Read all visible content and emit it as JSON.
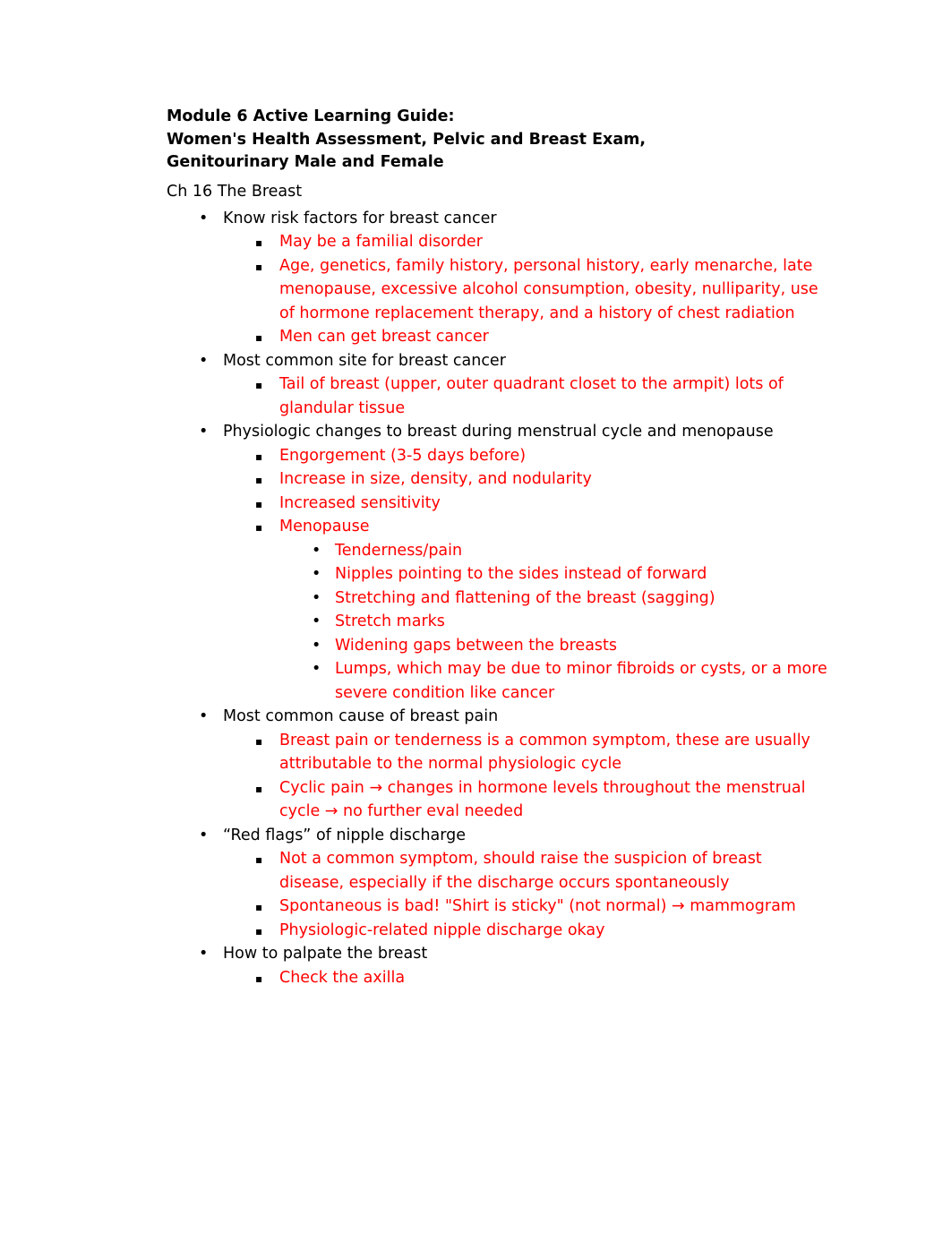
{
  "document": {
    "title_lines": [
      "Module 6 Active Learning Guide:",
      "Women's Health Assessment, Pelvic and Breast Exam,",
      "Genitourinary Male and Female"
    ],
    "chapter_heading": "Ch 16 The Breast",
    "colors": {
      "body_text": "#000000",
      "answer_text": "#ff0000",
      "page_background": "#ffffff"
    },
    "bullet_glyphs": {
      "level1": "•",
      "level2": "▪",
      "level3": "•"
    }
  },
  "outline": [
    {
      "id": "risk-factors",
      "text": "Know risk factors for breast cancer",
      "children": [
        {
          "id": "familial",
          "text": "May be a familial disorder"
        },
        {
          "id": "risk-list",
          "text": "Age, genetics, family history, personal history, early menarche, late menopause, excessive alcohol consumption, obesity, nulliparity, use of hormone replacement therapy, and a history of chest radiation"
        },
        {
          "id": "men-breast-cancer",
          "text": "Men can get breast cancer"
        }
      ]
    },
    {
      "id": "common-site",
      "text": "Most common site for breast cancer",
      "children": [
        {
          "id": "tail-of-breast",
          "text": "Tail of breast (upper, outer quadrant closet to the armpit) lots of glandular tissue"
        }
      ]
    },
    {
      "id": "physiologic-changes",
      "text": "Physiologic changes to breast during menstrual cycle and menopause",
      "children": [
        {
          "id": "engorgement",
          "text": "Engorgement (3-5 days before)"
        },
        {
          "id": "increase-size",
          "text": "Increase in size, density, and nodularity"
        },
        {
          "id": "increased-sensitivity",
          "text": "Increased sensitivity"
        },
        {
          "id": "menopause",
          "text": "Menopause",
          "children": [
            {
              "id": "tenderness-pain",
              "text": "Tenderness/pain"
            },
            {
              "id": "nipples-sides",
              "text": "Nipples pointing to the sides instead of forward"
            },
            {
              "id": "stretching-flattening",
              "text": "Stretching and flattening of the breast (sagging)"
            },
            {
              "id": "stretch-marks",
              "text": "Stretch marks"
            },
            {
              "id": "widening-gaps",
              "text": "Widening gaps between the breasts"
            },
            {
              "id": "lumps",
              "text": "Lumps, which may be due to minor fibroids or cysts, or a more severe condition like cancer"
            }
          ]
        }
      ]
    },
    {
      "id": "breast-pain-cause",
      "text": "Most common cause of breast pain",
      "children": [
        {
          "id": "breast-pain-common",
          "text": "Breast pain or tenderness is a common symptom, these are usually attributable to the normal physiologic cycle",
          "spaced": true
        },
        {
          "id": "cyclic-pain",
          "text": "Cyclic pain → changes in hormone levels throughout the menstrual cycle → no further eval needed"
        }
      ]
    },
    {
      "id": "red-flags-nipple-discharge",
      "text": "“Red flags” of nipple discharge",
      "children": [
        {
          "id": "not-common-symptom",
          "text": "Not a common symptom, should raise the suspicion of breast disease, especially if the discharge occurs spontaneously",
          "spaced": true
        },
        {
          "id": "spontaneous-bad",
          "text": "Spontaneous is bad! \"Shirt is sticky\" (not normal) → mammogram"
        },
        {
          "id": "physiologic-discharge-okay",
          "text": "Physiologic-related nipple discharge okay"
        }
      ]
    },
    {
      "id": "how-to-palpate",
      "text": "How to palpate the breast",
      "children": [
        {
          "id": "check-axilla",
          "text": "Check the axilla",
          "spaced": true
        }
      ]
    }
  ]
}
